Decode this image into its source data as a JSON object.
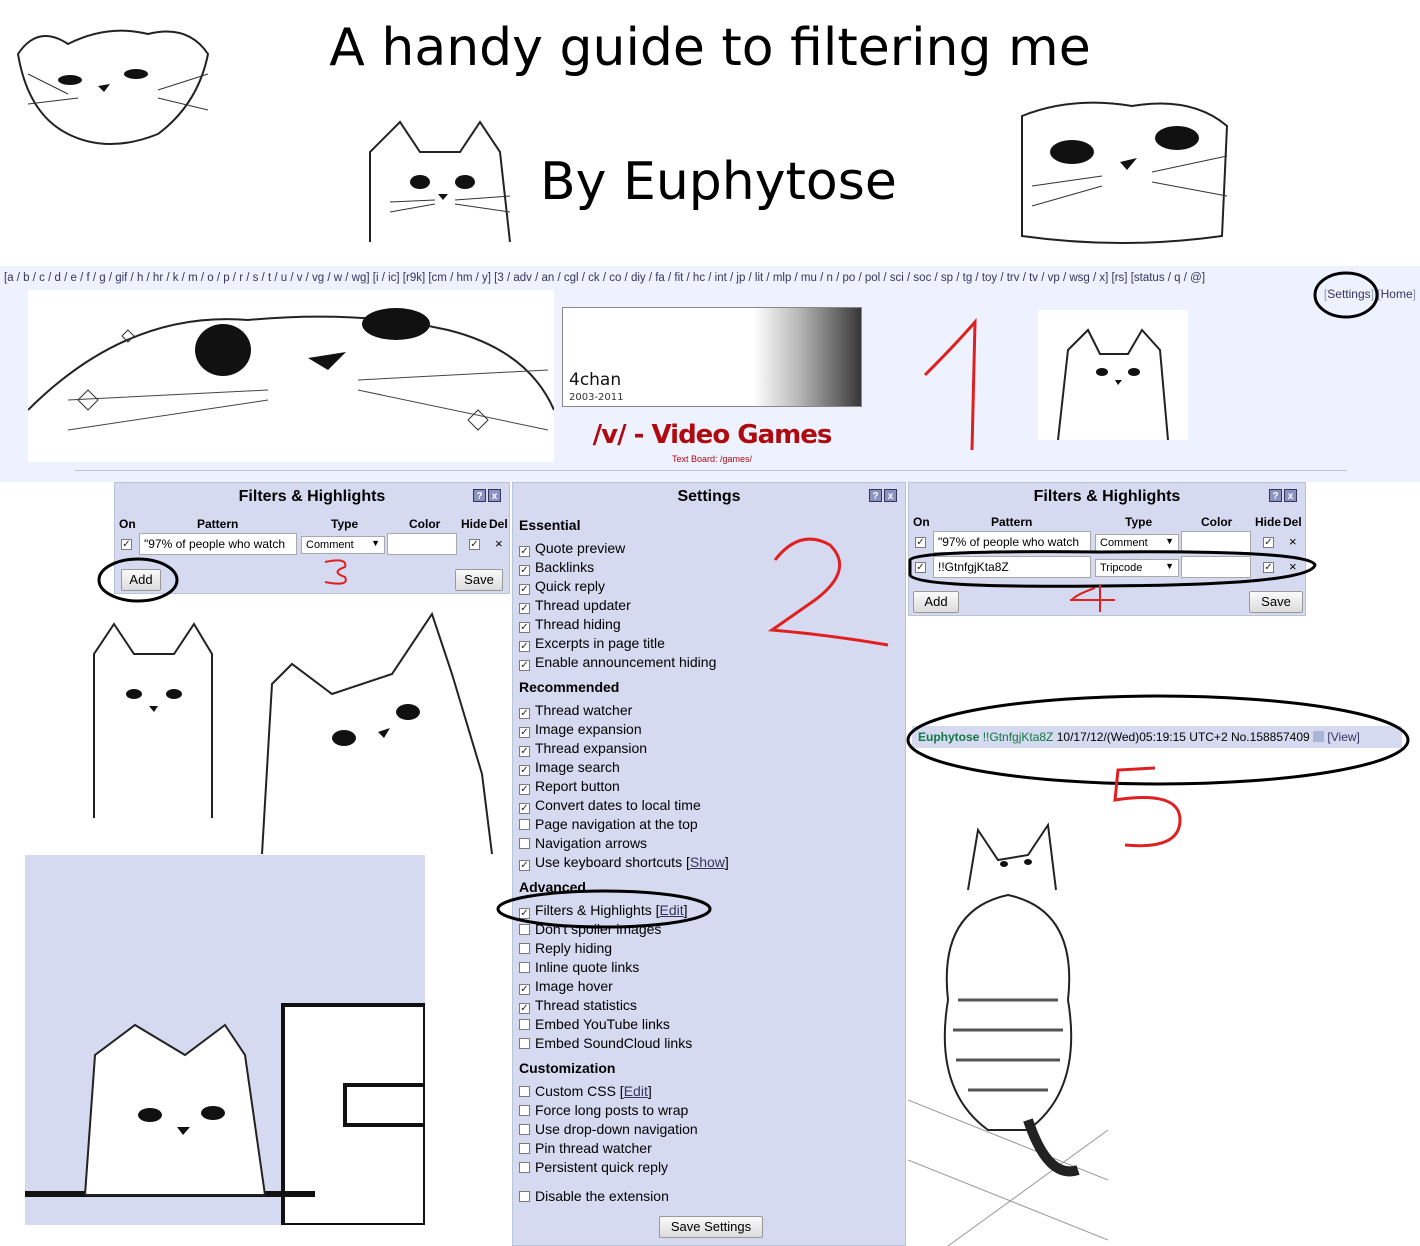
{
  "guide": {
    "title": "A handy guide to filtering me",
    "author": "By Euphytose"
  },
  "board_nav": {
    "text_pre": "[a / b / c / d / e / f / g / gif / h / hr / k / m / o / p / r / s / t / u / v / vg / w / wg] [i / ic] [r9k] [cm / hm / y] [3 / adv / an / cgl / ck / co / diy / fa / fit / hc / int / jp / lit / mlp / mu / n / po / pol / sci / soc / sp / tg / toy / trv / tv / vp / wsg / x] [rs] [status / q / @]",
    "settings_label": "Settings",
    "home_label": "Home"
  },
  "banner": {
    "logo": "4chan",
    "years": "2003-2011"
  },
  "board": {
    "title": "/v/ - Video Games",
    "text_board_prefix": "Text Board: /",
    "text_board_link": "games",
    "text_board_suffix": "/"
  },
  "filters_left": {
    "title": "Filters & Highlights",
    "columns": {
      "on": "On",
      "pattern": "Pattern",
      "type": "Type",
      "color": "Color",
      "hide": "Hide",
      "del": "Del"
    },
    "rows": [
      {
        "pattern": "\"97% of people who watch",
        "type": "Comment"
      }
    ],
    "add_label": "Add",
    "save_label": "Save"
  },
  "filters_right": {
    "title": "Filters & Highlights",
    "columns": {
      "on": "On",
      "pattern": "Pattern",
      "type": "Type",
      "color": "Color",
      "hide": "Hide",
      "del": "Del"
    },
    "rows": [
      {
        "pattern": "\"97% of people who watch",
        "type": "Comment"
      },
      {
        "pattern": "!!GtnfgjKta8Z",
        "type": "Tripcode"
      }
    ],
    "add_label": "Add",
    "save_label": "Save"
  },
  "settings": {
    "title": "Settings",
    "help_icon": "?",
    "close_icon": "x",
    "sections": {
      "essential": "Essential",
      "recommended": "Recommended",
      "advanced": "Advanced",
      "customization": "Customization"
    },
    "options": {
      "quote_preview": "Quote preview",
      "backlinks": "Backlinks",
      "quick_reply": "Quick reply",
      "thread_updater": "Thread updater",
      "thread_hiding": "Thread hiding",
      "excerpts": "Excerpts in page title",
      "announcement_hiding": "Enable announcement hiding",
      "thread_watcher": "Thread watcher",
      "image_expansion": "Image expansion",
      "thread_expansion": "Thread expansion",
      "image_search": "Image search",
      "report_button": "Report button",
      "convert_dates": "Convert dates to local time",
      "page_nav_top": "Page navigation at the top",
      "nav_arrows": "Navigation arrows",
      "keyboard_shortcuts": "Use keyboard shortcuts",
      "show_link": "Show",
      "filters_highlights": "Filters & Highlights",
      "edit_link": "Edit",
      "dont_spoiler": "Don't spoiler images",
      "reply_hiding": "Reply hiding",
      "inline_quote": "Inline quote links",
      "image_hover": "Image hover",
      "thread_statistics": "Thread statistics",
      "embed_youtube": "Embed YouTube links",
      "embed_soundcloud": "Embed SoundCloud links",
      "custom_css": "Custom CSS",
      "custom_css_edit": "Edit",
      "force_wrap": "Force long posts to wrap",
      "dropdown_nav": "Use drop-down navigation",
      "pin_watcher": "Pin thread watcher",
      "persistent_qr": "Persistent quick reply",
      "disable_ext": "Disable the extension"
    },
    "save_label": "Save Settings"
  },
  "post": {
    "name": "Euphytose",
    "tripcode": "!!GtnfgjKta8Z",
    "date": "10/17/12/(Wed)05:19:15 UTC+2",
    "number": "No.158857409",
    "view_label": "[View]"
  },
  "annotations": {
    "step1": "1",
    "step2": "2",
    "step3": "3",
    "step4": "4",
    "step5": "5"
  },
  "icons": [
    "help-icon",
    "close-icon",
    "checkbox-icon",
    "dropdown-arrow-icon",
    "delete-x-icon"
  ]
}
